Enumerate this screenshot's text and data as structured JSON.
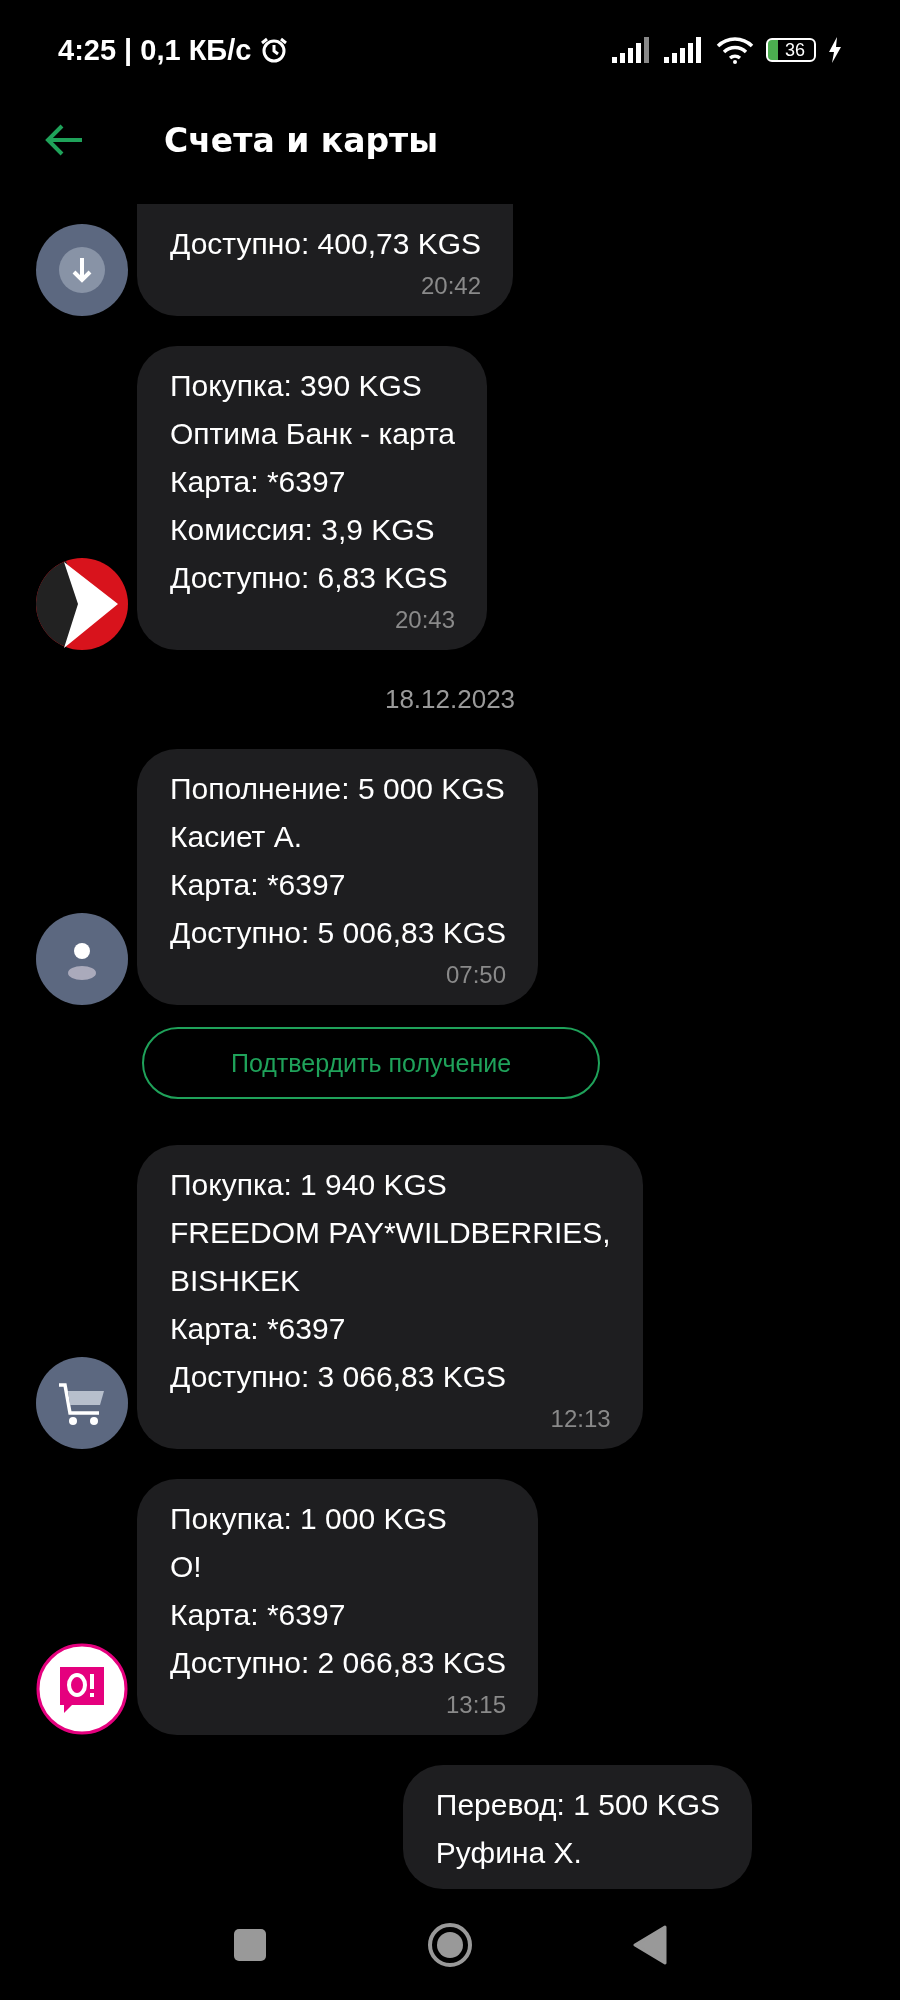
{
  "status_bar": {
    "time": "4:25 | 0,1 КБ/с",
    "battery": "36"
  },
  "header": {
    "title": "Счета и карты"
  },
  "feed": [
    {
      "kind": "incoming",
      "avatar": {
        "kind": "download"
      },
      "lines": [
        "Доступно: 400,73 KGS"
      ],
      "time": "20:42"
    },
    {
      "kind": "incoming",
      "avatar": {
        "kind": "bank"
      },
      "lines": [
        "Покупка: 390 KGS",
        "Оптима Банк - карта",
        "Карта: *6397",
        "Комиссия: 3,9 KGS",
        "Доступно: 6,83 KGS"
      ],
      "time": "20:43"
    },
    {
      "kind": "date",
      "text": "18.12.2023"
    },
    {
      "kind": "incoming",
      "avatar": {
        "kind": "person"
      },
      "lines": [
        "Пополнение: 5 000 KGS",
        "Касиет А.",
        "Карта: *6397",
        "Доступно: 5 006,83 KGS"
      ],
      "time": "07:50"
    },
    {
      "kind": "action",
      "label": "Подтвердить получение"
    },
    {
      "kind": "incoming",
      "avatar": {
        "kind": "cart"
      },
      "lines": [
        "Покупка: 1 940 KGS",
        "FREEDOM PAY*WILDBERRIES,",
        "BISHKEK",
        "Карта: *6397",
        "Доступно: 3 066,83 KGS"
      ],
      "time": "12:13"
    },
    {
      "kind": "incoming",
      "avatar": {
        "kind": "o"
      },
      "lines": [
        "Покупка: 1 000 KGS",
        "О!",
        "Карта: *6397",
        "Доступно: 2 066,83 KGS"
      ],
      "time": "13:15"
    },
    {
      "kind": "outgoing",
      "lines": [
        "Перевод: 1 500 KGS",
        "Руфина Х."
      ]
    }
  ]
}
